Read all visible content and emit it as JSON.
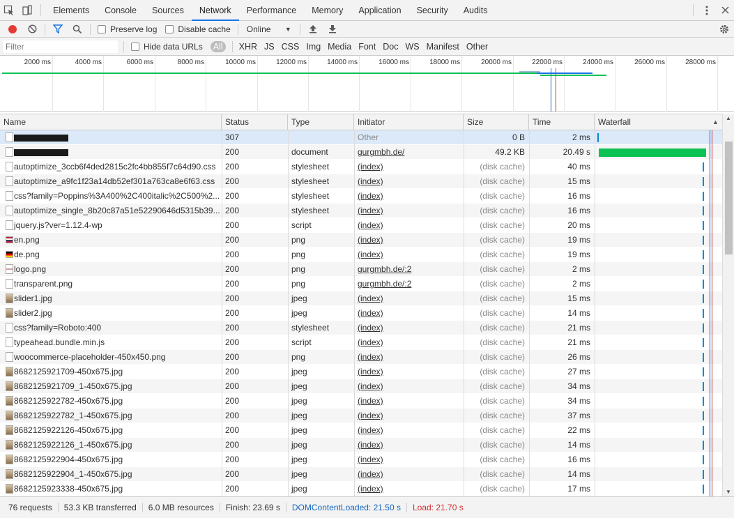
{
  "tabs": [
    "Elements",
    "Console",
    "Sources",
    "Network",
    "Performance",
    "Memory",
    "Application",
    "Security",
    "Audits"
  ],
  "active_tab": "Network",
  "toolbar": {
    "preserve_log": "Preserve log",
    "disable_cache": "Disable cache",
    "throttle": "Online"
  },
  "filter": {
    "placeholder": "Filter",
    "hide_data_urls": "Hide data URLs",
    "types": [
      "All",
      "XHR",
      "JS",
      "CSS",
      "Img",
      "Media",
      "Font",
      "Doc",
      "WS",
      "Manifest",
      "Other"
    ]
  },
  "overview_ticks": [
    "2000 ms",
    "4000 ms",
    "6000 ms",
    "8000 ms",
    "10000 ms",
    "12000 ms",
    "14000 ms",
    "16000 ms",
    "18000 ms",
    "20000 ms",
    "22000 ms",
    "24000 ms",
    "26000 ms",
    "28000 ms"
  ],
  "columns": [
    "Name",
    "Status",
    "Type",
    "Initiator",
    "Size",
    "Time",
    "Waterfall"
  ],
  "rows": [
    {
      "name": "",
      "redacted": true,
      "status": "307",
      "type": "",
      "initiator": "Other",
      "size": "0 B",
      "time": "2 ms",
      "icon": "doc-icon"
    },
    {
      "name": "",
      "redacted": true,
      "status": "200",
      "type": "document",
      "initiator": "gurgmbh.de/",
      "size": "49.2 KB",
      "time": "20.49 s",
      "icon": "doc-icon"
    },
    {
      "name": "autoptimize_3ccb6f4ded2815c2fc4bb855f7c64d90.css",
      "status": "200",
      "type": "stylesheet",
      "initiator": "(index)",
      "size": "(disk cache)",
      "time": "40 ms",
      "icon": "doc-icon"
    },
    {
      "name": "autoptimize_a9fc1f23a14db52ef301a763ca8e6f63.css",
      "status": "200",
      "type": "stylesheet",
      "initiator": "(index)",
      "size": "(disk cache)",
      "time": "15 ms",
      "icon": "doc-icon"
    },
    {
      "name": "css?family=Poppins%3A400%2C400italic%2C500%2...",
      "status": "200",
      "type": "stylesheet",
      "initiator": "(index)",
      "size": "(disk cache)",
      "time": "16 ms",
      "icon": "doc-icon"
    },
    {
      "name": "autoptimize_single_8b20c87a51e52290646d5315b39...",
      "status": "200",
      "type": "stylesheet",
      "initiator": "(index)",
      "size": "(disk cache)",
      "time": "16 ms",
      "icon": "doc-icon"
    },
    {
      "name": "jquery.js?ver=1.12.4-wp",
      "status": "200",
      "type": "script",
      "initiator": "(index)",
      "size": "(disk cache)",
      "time": "20 ms",
      "icon": "doc-icon"
    },
    {
      "name": "en.png",
      "status": "200",
      "type": "png",
      "initiator": "(index)",
      "size": "(disk cache)",
      "time": "19 ms",
      "icon": "flag-en-icon"
    },
    {
      "name": "de.png",
      "status": "200",
      "type": "png",
      "initiator": "(index)",
      "size": "(disk cache)",
      "time": "19 ms",
      "icon": "flag-de-icon"
    },
    {
      "name": "logo.png",
      "status": "200",
      "type": "png",
      "initiator": "gurgmbh.de/:2",
      "size": "(disk cache)",
      "time": "2 ms",
      "icon": "logo-thumb-icon"
    },
    {
      "name": "transparent.png",
      "status": "200",
      "type": "png",
      "initiator": "gurgmbh.de/:2",
      "size": "(disk cache)",
      "time": "2 ms",
      "icon": "doc-icon"
    },
    {
      "name": "slider1.jpg",
      "status": "200",
      "type": "jpeg",
      "initiator": "(index)",
      "size": "(disk cache)",
      "time": "15 ms",
      "icon": "image-thumb-icon"
    },
    {
      "name": "slider2.jpg",
      "status": "200",
      "type": "jpeg",
      "initiator": "(index)",
      "size": "(disk cache)",
      "time": "14 ms",
      "icon": "image-thumb-icon"
    },
    {
      "name": "css?family=Roboto:400",
      "status": "200",
      "type": "stylesheet",
      "initiator": "(index)",
      "size": "(disk cache)",
      "time": "21 ms",
      "icon": "doc-icon"
    },
    {
      "name": "typeahead.bundle.min.js",
      "status": "200",
      "type": "script",
      "initiator": "(index)",
      "size": "(disk cache)",
      "time": "21 ms",
      "icon": "doc-icon"
    },
    {
      "name": "woocommerce-placeholder-450x450.png",
      "status": "200",
      "type": "png",
      "initiator": "(index)",
      "size": "(disk cache)",
      "time": "26 ms",
      "icon": "doc-icon"
    },
    {
      "name": "8682125921709-450x675.jpg",
      "status": "200",
      "type": "jpeg",
      "initiator": "(index)",
      "size": "(disk cache)",
      "time": "27 ms",
      "icon": "image-thumb-icon"
    },
    {
      "name": "8682125921709_1-450x675.jpg",
      "status": "200",
      "type": "jpeg",
      "initiator": "(index)",
      "size": "(disk cache)",
      "time": "34 ms",
      "icon": "image-thumb-icon"
    },
    {
      "name": "8682125922782-450x675.jpg",
      "status": "200",
      "type": "jpeg",
      "initiator": "(index)",
      "size": "(disk cache)",
      "time": "34 ms",
      "icon": "image-thumb-icon"
    },
    {
      "name": "8682125922782_1-450x675.jpg",
      "status": "200",
      "type": "jpeg",
      "initiator": "(index)",
      "size": "(disk cache)",
      "time": "37 ms",
      "icon": "image-thumb-icon"
    },
    {
      "name": "8682125922126-450x675.jpg",
      "status": "200",
      "type": "jpeg",
      "initiator": "(index)",
      "size": "(disk cache)",
      "time": "22 ms",
      "icon": "image-thumb-icon"
    },
    {
      "name": "8682125922126_1-450x675.jpg",
      "status": "200",
      "type": "jpeg",
      "initiator": "(index)",
      "size": "(disk cache)",
      "time": "14 ms",
      "icon": "image-thumb-icon"
    },
    {
      "name": "8682125922904-450x675.jpg",
      "status": "200",
      "type": "jpeg",
      "initiator": "(index)",
      "size": "(disk cache)",
      "time": "16 ms",
      "icon": "image-thumb-icon"
    },
    {
      "name": "8682125922904_1-450x675.jpg",
      "status": "200",
      "type": "jpeg",
      "initiator": "(index)",
      "size": "(disk cache)",
      "time": "14 ms",
      "icon": "image-thumb-icon"
    },
    {
      "name": "8682125923338-450x675.jpg",
      "status": "200",
      "type": "jpeg",
      "initiator": "(index)",
      "size": "(disk cache)",
      "time": "17 ms",
      "icon": "image-thumb-icon"
    }
  ],
  "status": {
    "requests": "76 requests",
    "transferred": "53.3 KB transferred",
    "resources": "6.0 MB resources",
    "finish": "Finish: 23.69 s",
    "dcl": "DOMContentLoaded: 21.50 s",
    "load": "Load: 21.70 s"
  },
  "colors": {
    "accent": "#1a73e8",
    "record": "#e53935",
    "waterfall_bar": "#0cc254",
    "waterfall_tick": "#0288d1",
    "dcl_line": "#1565c0",
    "load_line": "#d32f2f"
  }
}
